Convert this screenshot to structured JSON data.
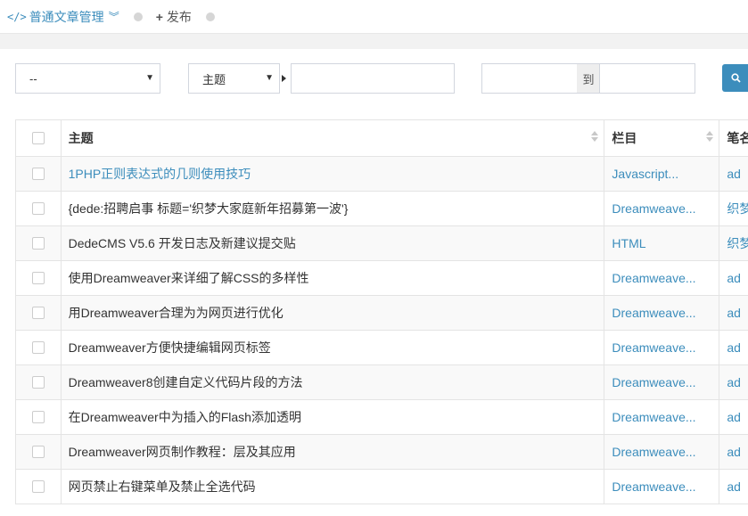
{
  "header": {
    "tab_active_icon": "</>",
    "tab_active_label": "普通文章管理",
    "tab_publish_icon": "+",
    "tab_publish_label": "发布"
  },
  "filters": {
    "category_select": "--",
    "field_select": "主题",
    "range_separator": "到"
  },
  "table": {
    "headers": {
      "title": "主题",
      "column": "栏目",
      "author": "笔名"
    },
    "rows": [
      {
        "title": "1PHP正则表达式的几则使用技巧",
        "title_link": true,
        "column": "Javascript...",
        "author": "ad"
      },
      {
        "title": "{dede:招聘启事 标题='织梦大家庭新年招募第一波'}",
        "title_link": false,
        "column": "Dreamweave...",
        "author": "织梦"
      },
      {
        "title": "DedeCMS V5.6 开发日志及新建议提交贴",
        "title_link": false,
        "column": "HTML",
        "author": "织梦"
      },
      {
        "title": "使用Dreamweaver来详细了解CSS的多样性",
        "title_link": false,
        "column": "Dreamweave...",
        "author": "ad"
      },
      {
        "title": "用Dreamweaver合理为为网页进行优化",
        "title_link": false,
        "column": "Dreamweave...",
        "author": "ad"
      },
      {
        "title": "Dreamweaver方便快捷编辑网页标签",
        "title_link": false,
        "column": "Dreamweave...",
        "author": "ad"
      },
      {
        "title": "Dreamweaver8创建自定义代码片段的方法",
        "title_link": false,
        "column": "Dreamweave...",
        "author": "ad"
      },
      {
        "title": "在Dreamweaver中为插入的Flash添加透明",
        "title_link": false,
        "column": "Dreamweave...",
        "author": "ad"
      },
      {
        "title": "Dreamweaver网页制作教程：层及其应用",
        "title_link": false,
        "column": "Dreamweave...",
        "author": "ad"
      },
      {
        "title": "网页禁止右键菜单及禁止全选代码",
        "title_link": false,
        "column": "Dreamweave...",
        "author": "ad"
      }
    ]
  },
  "colors": {
    "accent": "#3c8dbc",
    "stripe": "#f9f9f9",
    "border": "#e4e4e4"
  }
}
